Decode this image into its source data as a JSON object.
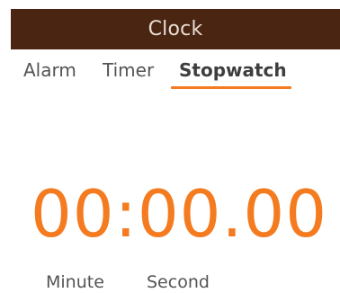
{
  "app": {
    "title": "Clock"
  },
  "tabs": {
    "items": [
      {
        "label": "Alarm"
      },
      {
        "label": "Timer"
      },
      {
        "label": "Stopwatch"
      }
    ],
    "selected": "Stopwatch"
  },
  "stopwatch": {
    "time_display": "00:00.00",
    "minute_label": "Minute",
    "second_label": "Second"
  },
  "colors": {
    "title_bar": "#4a2512",
    "accent": "#f47b20",
    "tab_text": "#545454"
  }
}
